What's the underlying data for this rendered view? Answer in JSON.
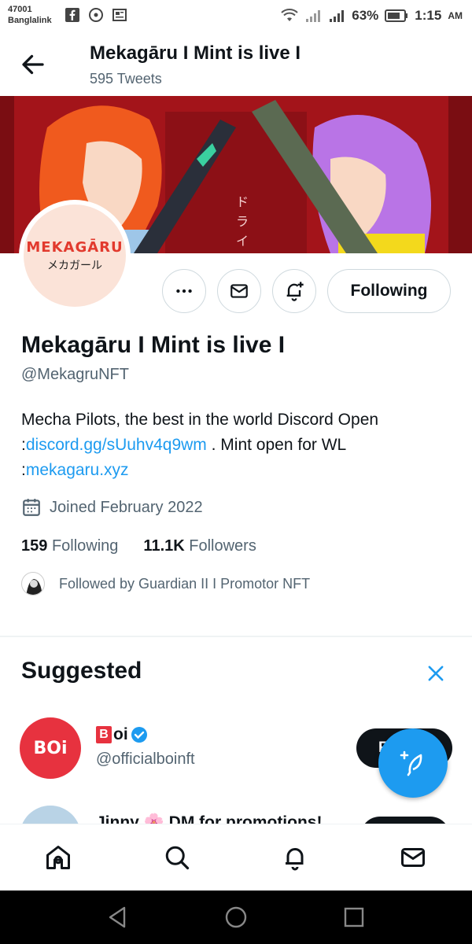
{
  "status_bar": {
    "carrier_code": "47001",
    "carrier_name": "Banglalink",
    "battery": "63%",
    "time": "1:15",
    "ampm": "AM"
  },
  "header": {
    "title": "Mekagāru I Mint is live I",
    "tweet_count": "595 Tweets"
  },
  "avatar": {
    "logo_text": "MEKAGĀRU",
    "logo_kana": "メカガール"
  },
  "actions": {
    "following_label": "Following"
  },
  "profile": {
    "name": "Mekagāru I Mint is live I",
    "handle": "@MekagruNFT",
    "bio_text1": "Mecha Pilots, the best in the world Discord Open",
    "bio_prefix2": ":",
    "bio_link1": "discord.gg/sUuhv4q9wm",
    "bio_text2": " . Mint open for WL",
    "bio_prefix3": ":",
    "bio_link2": "mekagaru.xyz",
    "joined": "Joined February 2022",
    "following_count": "159",
    "following_label": "Following",
    "followers_count": "11.1K",
    "followers_label": "Followers",
    "followed_by": "Followed by Guardian II I Promotor NFT"
  },
  "suggested": {
    "title": "Suggested",
    "items": [
      {
        "avatar_text": "BOi",
        "name_badge": "B",
        "name": "oi",
        "handle": "@officialboinft",
        "follow_label": "F"
      },
      {
        "name": "Jinny 🌸 DM for promotions!"
      }
    ]
  },
  "colors": {
    "accent": "#1d9bf0",
    "text_primary": "#0f1419",
    "text_secondary": "#536471",
    "banner_red": "#a3141a",
    "logo_red": "#e23a2e"
  },
  "icons": {
    "header_back": "arrow-left-icon",
    "more": "more-horizontal-icon",
    "message": "envelope-icon",
    "notify": "bell-plus-icon",
    "calendar": "calendar-icon",
    "verified": "verified-badge-icon",
    "compose": "feather-plus-icon",
    "nav": [
      "home-icon",
      "search-icon",
      "bell-icon",
      "mail-icon"
    ]
  }
}
